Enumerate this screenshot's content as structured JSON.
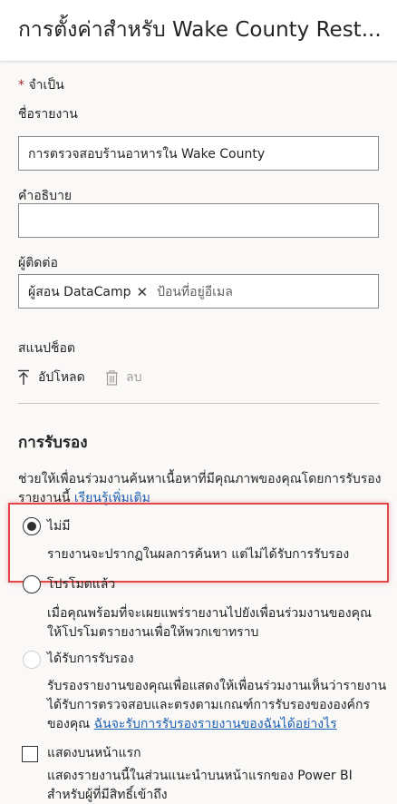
{
  "header": {
    "title": "การตั้งค่าสำหรับ Wake County Rest..."
  },
  "required_note": {
    "star": "*",
    "text": "จำเป็น"
  },
  "report_name": {
    "label": "ชื่อรายงาน",
    "value": "การตรวจสอบร้านอาหารใน Wake County"
  },
  "description": {
    "label": "คำอธิบาย",
    "value": ""
  },
  "contacts": {
    "label": "ผู้ติดต่อ",
    "chip": "ผู้สอน DataCamp",
    "chip_remove": "✕",
    "placeholder": "ป้อนที่อยู่อีเมล"
  },
  "snapshot": {
    "label": "สแนปช็อต",
    "upload_label": "อัปโหลด",
    "delete_label": "ลบ"
  },
  "endorsement": {
    "title": "การรับรอง",
    "help_text": "ช่วยให้เพื่อนร่วมงานค้นหาเนื้อหาที่มีคุณภาพของคุณโดยการรับรองรายงานนี้",
    "help_link": "เรียนรู้เพิ่มเติม",
    "options": [
      {
        "label": "ไม่มี",
        "description": "รายงานจะปรากฏในผลการค้นหา แต่ไม่ได้รับการรับรอง"
      },
      {
        "label": "โปรโมตแล้ว",
        "description": "เมื่อคุณพร้อมที่จะเผยแพร่รายงานไปยังเพื่อนร่วมงานของคุณ ให้โปรโมตรายงานเพื่อให้พวกเขาทราบ"
      },
      {
        "label": "ได้รับการรับรอง",
        "description": "รับรองรายงานของคุณเพื่อแสดงให้เพื่อนร่วมงานเห็นว่ารายงานได้รับการตรวจสอบและตรงตามเกณฑ์การรับรองขององค์กรของคุณ",
        "link": "ฉันจะรับการรับรองรายงานของฉันได้อย่างไร"
      }
    ],
    "selected": "ไม่มี"
  },
  "featured": {
    "label": "แสดงบนหน้าแรก",
    "description": "แสดงรายงานนี้ในส่วนแนะนำบนหน้าแรกของ Power BI สำหรับผู้ที่มีสิทธิ์เข้าถึง"
  },
  "colors": {
    "highlight": "#e0464a",
    "link": "#1b5fb3"
  }
}
